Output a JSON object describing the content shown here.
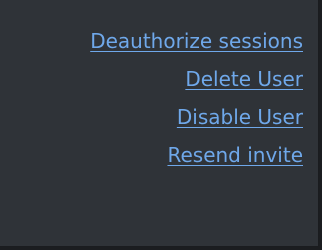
{
  "user_actions": {
    "items": [
      {
        "label": "Deauthorize sessions"
      },
      {
        "label": "Delete User"
      },
      {
        "label": "Disable User"
      },
      {
        "label": "Resend invite"
      }
    ]
  },
  "colors": {
    "panel_background": "#2f3338",
    "link": "#6fa8ea"
  }
}
